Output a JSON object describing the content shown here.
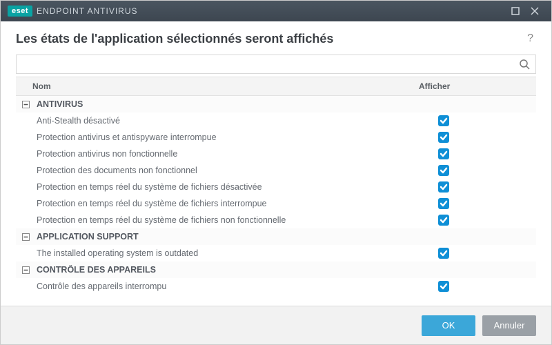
{
  "titlebar": {
    "brand_badge": "eset",
    "brand_text": "ENDPOINT ANTIVIRUS"
  },
  "heading": "Les états de l'application sélectionnés seront affichés",
  "columns": {
    "name": "Nom",
    "show": "Afficher"
  },
  "search": {
    "placeholder": ""
  },
  "groups": [
    {
      "name": "ANTIVIRUS",
      "items": [
        {
          "label": "Anti-Stealth désactivé",
          "checked": true
        },
        {
          "label": "Protection antivirus et antispyware interrompue",
          "checked": true
        },
        {
          "label": "Protection antivirus non fonctionnelle",
          "checked": true
        },
        {
          "label": "Protection des documents non fonctionnel",
          "checked": true
        },
        {
          "label": "Protection en temps réel du système de fichiers désactivée",
          "checked": true
        },
        {
          "label": "Protection en temps réel du système de fichiers interrompue",
          "checked": true
        },
        {
          "label": "Protection en temps réel du système de fichiers non fonctionnelle",
          "checked": true
        }
      ]
    },
    {
      "name": "APPLICATION SUPPORT",
      "items": [
        {
          "label": "The installed operating system is outdated",
          "checked": true
        }
      ]
    },
    {
      "name": "CONTRÔLE DES APPAREILS",
      "items": [
        {
          "label": "Contrôle des appareils interrompu",
          "checked": true
        }
      ]
    }
  ],
  "buttons": {
    "ok": "OK",
    "cancel": "Annuler"
  }
}
